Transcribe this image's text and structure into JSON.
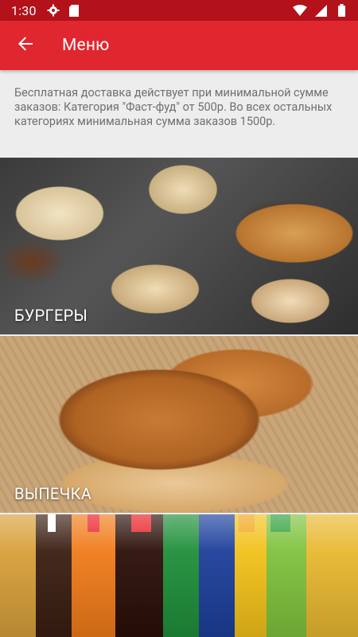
{
  "status_bar": {
    "time": "1:30",
    "icons": [
      "gear-icon",
      "sd-card-icon",
      "wifi-icon",
      "signal-icon",
      "battery-icon"
    ]
  },
  "app_bar": {
    "title": "Меню",
    "back_icon": "arrow-back-icon",
    "color": "#e0262e"
  },
  "notice": {
    "text": "Бесплатная доставка действует при минимальной сумме заказов: Категория \"Фаст-фуд\" от 500р. Во всех остальных категориях минимальная сумма заказов 1500р."
  },
  "categories": [
    {
      "label": "БУРГЕРЫ"
    },
    {
      "label": "ВЫПЕЧКА"
    },
    {
      "label": ""
    }
  ]
}
